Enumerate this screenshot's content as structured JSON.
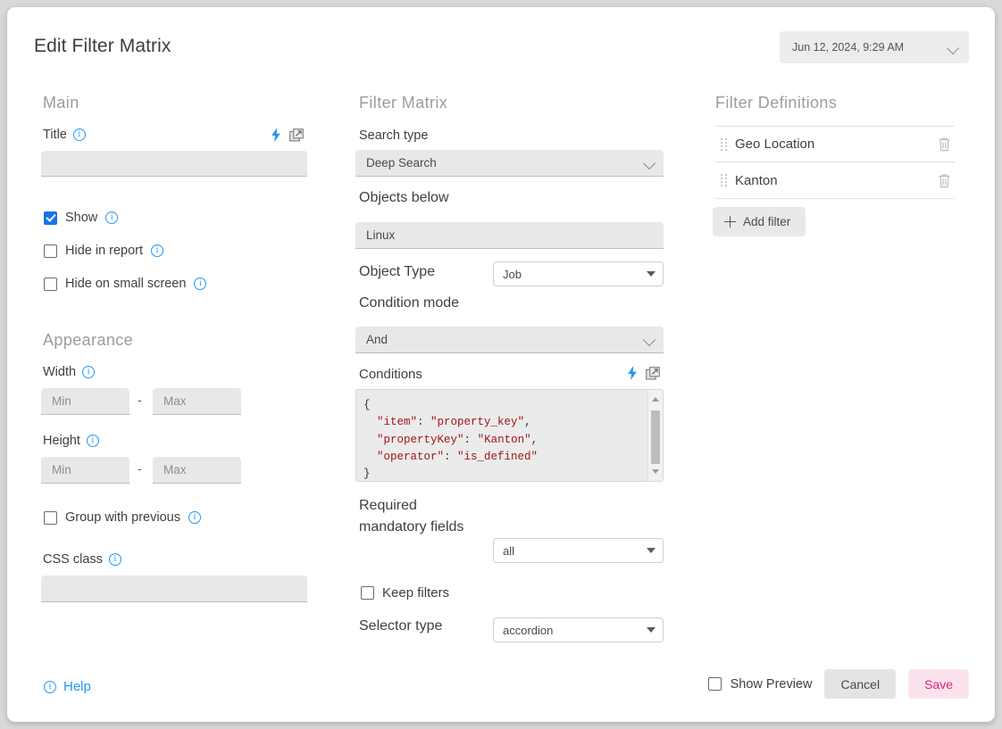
{
  "dialog": {
    "title": "Edit Filter Matrix",
    "date_select": {
      "value": "Jun 12, 2024, 9:29 AM",
      "icon": "chevron-down-icon"
    }
  },
  "main": {
    "heading": "Main",
    "title_field": {
      "label": "Title",
      "value": "",
      "placeholder": "",
      "info_icon": "info-icon",
      "bolt_icon": "lightning-bolt-icon",
      "popout_icon": "open-in-new-icon"
    },
    "checkboxes": [
      {
        "label": "Show",
        "checked": true
      },
      {
        "label": "Hide in report",
        "checked": false
      },
      {
        "label": "Hide on small screen",
        "checked": false
      }
    ]
  },
  "appearance": {
    "heading": "Appearance",
    "width": {
      "label": "Width",
      "min_placeholder": "Min",
      "max_placeholder": "Max",
      "min_value": "",
      "max_value": "",
      "separator": "-"
    },
    "height": {
      "label": "Height",
      "min_placeholder": "Min",
      "max_placeholder": "Max",
      "min_value": "",
      "max_value": "",
      "separator": "-"
    },
    "group_with_previous": {
      "label": "Group with previous",
      "checked": false
    },
    "css_class": {
      "label": "CSS class",
      "value": "",
      "placeholder": ""
    }
  },
  "filter_matrix": {
    "heading": "Filter Matrix",
    "search_type": {
      "label": "Search type",
      "value": "Deep Search"
    },
    "objects_below": {
      "label": "Objects below",
      "value": "Linux"
    },
    "object_type": {
      "label": "Object Type",
      "value": "Job"
    },
    "condition_mode": {
      "label": "Condition mode",
      "value": "And"
    },
    "conditions": {
      "label": "Conditions",
      "lines": [
        {
          "pre": "{",
          "parts": []
        },
        {
          "pre": "  ",
          "key": "\"item\"",
          "sep": ": ",
          "val": "\"property_key\"",
          "post": ","
        },
        {
          "pre": "  ",
          "key": "\"propertyKey\"",
          "sep": ": ",
          "val": "\"Kanton\"",
          "post": ","
        },
        {
          "pre": "  ",
          "key": "\"operator\"",
          "sep": ": ",
          "val": "\"is_defined\"",
          "post": ""
        },
        {
          "pre": "}",
          "parts": []
        }
      ],
      "raw": "{\n  \"item\": \"property_key\",\n  \"propertyKey\": \"Kanton\",\n  \"operator\": \"is_defined\"\n}"
    },
    "required_mandatory_fields": {
      "label": "Required mandatory fields",
      "value": "all"
    },
    "keep_filters": {
      "label": "Keep filters",
      "checked": false
    },
    "selector_type": {
      "label": "Selector type",
      "value": "accordion"
    }
  },
  "filter_definitions": {
    "heading": "Filter Definitions",
    "items": [
      {
        "name": "Geo Location",
        "drag_icon": "drag-handle-icon",
        "delete_icon": "trash-icon"
      },
      {
        "name": "Kanton",
        "drag_icon": "drag-handle-icon",
        "delete_icon": "trash-icon"
      }
    ],
    "add_button": "Add filter"
  },
  "footer": {
    "help": "Help",
    "show_preview": {
      "label": "Show Preview",
      "checked": false
    },
    "cancel": "Cancel",
    "save": "Save"
  },
  "colors": {
    "accent_blue": "#2196f3",
    "save_text": "#e5207e",
    "save_bg": "#fbe3ee",
    "checkbox_checked": "#1a73e8",
    "heading_gray": "#9c9c9c"
  }
}
